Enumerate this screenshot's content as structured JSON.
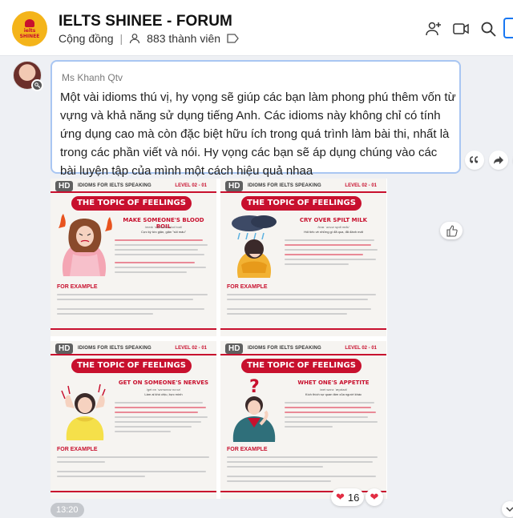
{
  "header": {
    "title": "IELTS SHINEE - FORUM",
    "category": "Cộng đồng",
    "members": "883 thành viên",
    "logo_text_1": "ielts",
    "logo_text_2": "SHINEE",
    "icons": [
      "add-member-icon",
      "video-call-icon",
      "search-icon",
      "sidebar-toggle-icon"
    ]
  },
  "message": {
    "sender": "Ms Khanh Qtv",
    "text": "Một vài idioms thú vị, hy vọng sẽ giúp các bạn làm phong phú thêm vốn từ vựng và khả năng sử dụng tiếng Anh. Các idioms này không chỉ có tính ứng dụng cao mà còn đặc biệt hữu ích trong quá trình làm bài thi, nhất là trong các phần viết và nói. Hy vọng các bạn sẽ áp dụng chúng vào các bài luyện tập của mình một cách hiệu quả nhaa",
    "time": "13:20",
    "reaction_count": "16"
  },
  "images": [
    {
      "hd": "HD",
      "series": "IDIOMS FOR IELTS SPEAKING",
      "level": "LEVEL 02 - 01",
      "topic": "THE TOPIC OF FEELINGS",
      "idiom": "MAKE SOMEONE'S BLOOD BOIL",
      "pron": "/meɪk ˈsʌmwʌnz blʌd bɔɪl/",
      "meaning": "Cực kỳ tức giận, giận \"sôi máu\"",
      "fe": "FOR EXAMPLE"
    },
    {
      "hd": "HD",
      "series": "IDIOMS FOR IELTS SPEAKING",
      "level": "LEVEL 02 - 01",
      "topic": "THE TOPIC OF FEELINGS",
      "idiom": "CRY OVER SPILT MILK",
      "pron": "/kraɪ ˈəʊvər spɪlt mɪlk/",
      "meaning": "Hối tiếc về những gì đã qua, đã đánh mất",
      "fe": "FOR EXAMPLE"
    },
    {
      "hd": "HD",
      "series": "IDIOMS FOR IELTS SPEAKING",
      "level": "LEVEL 02 - 01",
      "topic": "THE TOPIC OF FEELINGS",
      "idiom": "GET ON SOMEONE'S NERVES",
      "pron": "/ɡet ɒn ˈsʌmwʌnz nɜːvz/",
      "meaning": "Làm ai khó chịu, bực mình",
      "fe": "FOR EXAMPLE"
    },
    {
      "hd": "HD",
      "series": "IDIOMS FOR IELTS SPEAKING",
      "level": "LEVEL 02 - 01",
      "topic": "THE TOPIC OF FEELINGS",
      "idiom": "WHET ONE'S APPETITE",
      "pron": "/wet wʌnz ˈæpɪtaɪt/",
      "meaning": "Kích thích sự quan tâm của người khác",
      "fe": "FOR EXAMPLE"
    }
  ]
}
